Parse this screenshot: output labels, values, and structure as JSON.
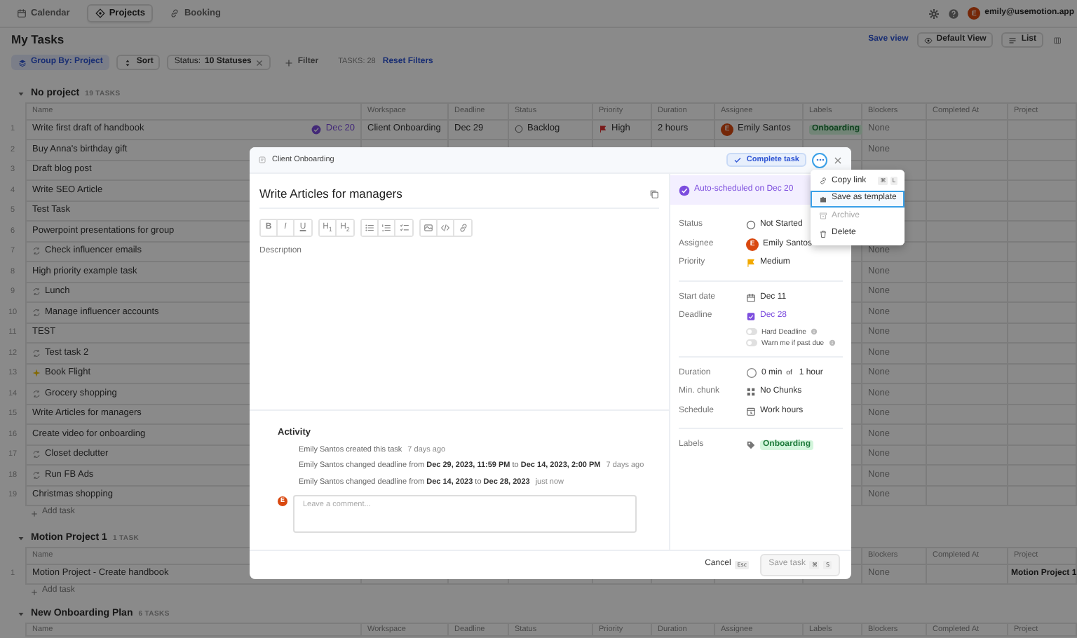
{
  "nav": {
    "tabs": [
      {
        "kind": "calendar",
        "label": "Calendar",
        "selected": false
      },
      {
        "kind": "projects",
        "label": "Projects",
        "selected": true
      },
      {
        "kind": "booking",
        "label": "Booking",
        "selected": false
      }
    ],
    "user": {
      "initial": "E",
      "email": "emily@usemotion.app"
    }
  },
  "page": {
    "title": "My Tasks",
    "save_view": "Save view",
    "view_button": "Default View",
    "view_modes": [
      {
        "kind": "list",
        "label": "List",
        "selected": true
      },
      {
        "kind": "board",
        "selected": false
      }
    ]
  },
  "filters": {
    "group_by": "Group By: Project",
    "sort": "Sort",
    "status_label": "Status:",
    "status_value": "10 Statuses",
    "add_filter": "Filter",
    "task_count": "TASKS: 28",
    "reset": "Reset Filters"
  },
  "groups": [
    {
      "name": "No project",
      "count": "19 TASKS",
      "columns": [
        {
          "kind": "name",
          "label": "Name"
        },
        {
          "kind": "workspace",
          "label": "Workspace"
        },
        {
          "kind": "deadline",
          "label": "Deadline"
        },
        {
          "kind": "status",
          "label": "Status"
        },
        {
          "kind": "priority",
          "label": "Priority"
        },
        {
          "kind": "duration",
          "label": "Duration"
        },
        {
          "kind": "assignee",
          "label": "Assignee"
        },
        {
          "kind": "labels",
          "label": "Labels"
        },
        {
          "kind": "blockers",
          "label": "Blockers"
        },
        {
          "kind": "completed",
          "label": "Completed At"
        },
        {
          "kind": "project",
          "label": "Project"
        }
      ],
      "rows": [
        {
          "num": "1",
          "kind": "task",
          "name": "Write first draft of handbook",
          "scheduled": "Dec 20",
          "workspace": "Client Onboarding",
          "deadline": "Dec 29",
          "status": "Backlog",
          "priority": "High",
          "duration": "2 hours",
          "assignee_initial": "E",
          "assignee": "Emily Santos",
          "labels": "Onboarding",
          "blockers": "None"
        },
        {
          "num": "2",
          "kind": "task",
          "name": "Buy Anna's birthday gift",
          "blockers": "None"
        },
        {
          "num": "3",
          "kind": "task",
          "name": "Draft blog post"
        },
        {
          "num": "4",
          "kind": "task",
          "name": "Write SEO Article"
        },
        {
          "num": "5",
          "kind": "task",
          "name": "Test Task"
        },
        {
          "num": "6",
          "kind": "task",
          "name": "Powerpoint presentations for group"
        },
        {
          "num": "7",
          "kind": "recurring",
          "name": "Check influencer emails",
          "blockers": "None"
        },
        {
          "num": "8",
          "kind": "task",
          "name": "High priority example task",
          "blockers": "None"
        },
        {
          "num": "9",
          "kind": "recurring",
          "name": "Lunch",
          "blockers": "None"
        },
        {
          "num": "10",
          "kind": "recurring",
          "name": "Manage influencer accounts",
          "blockers": "None"
        },
        {
          "num": "11",
          "kind": "task",
          "name": "TEST",
          "blockers": "None"
        },
        {
          "num": "12",
          "kind": "recurring",
          "name": "Test task 2",
          "blockers": "None"
        },
        {
          "num": "13",
          "kind": "sparkle",
          "name": "Book Flight",
          "blockers": "None"
        },
        {
          "num": "14",
          "kind": "recurring",
          "name": "Grocery shopping",
          "blockers": "None"
        },
        {
          "num": "15",
          "kind": "task",
          "name": "Write Articles for managers",
          "blockers": "None"
        },
        {
          "num": "16",
          "kind": "task",
          "name": "Create video for onboarding",
          "blockers": "None"
        },
        {
          "num": "17",
          "kind": "recurring",
          "name": "Closet declutter",
          "blockers": "None"
        },
        {
          "num": "18",
          "kind": "recurring",
          "name": "Run FB Ads",
          "blockers": "None"
        },
        {
          "num": "19",
          "kind": "task",
          "name": "Christmas shopping",
          "blockers": "None"
        }
      ],
      "add_task": "Add task"
    },
    {
      "name": "Motion Project 1",
      "count": "1 TASK",
      "columns": [
        {
          "kind": "name",
          "label": "Name"
        },
        {
          "kind": "blockers",
          "label": "Blockers"
        },
        {
          "kind": "completed",
          "label": "Completed At"
        },
        {
          "kind": "project",
          "label": "Project"
        }
      ],
      "rows": [
        {
          "num": "1",
          "kind": "task",
          "name": "Motion Project - Create handbook",
          "blockers": "None",
          "project": "Motion Project 1"
        }
      ],
      "add_task": "Add task"
    },
    {
      "name": "New Onboarding Plan",
      "count": "6 TASKS",
      "columns": [
        {
          "kind": "name",
          "label": "Name"
        },
        {
          "kind": "workspace",
          "label": "Workspace"
        },
        {
          "kind": "deadline",
          "label": "Deadline"
        },
        {
          "kind": "status",
          "label": "Status"
        },
        {
          "kind": "priority",
          "label": "Priority"
        },
        {
          "kind": "duration",
          "label": "Duration"
        },
        {
          "kind": "assignee",
          "label": "Assignee"
        },
        {
          "kind": "labels",
          "label": "Labels"
        },
        {
          "kind": "blockers",
          "label": "Blockers"
        },
        {
          "kind": "completed",
          "label": "Completed At"
        },
        {
          "kind": "project",
          "label": "Project"
        }
      ]
    }
  ],
  "modal": {
    "breadcrumb": "Client Onboarding",
    "complete": "Complete task",
    "title": "Write Articles for managers",
    "toolbar": [
      [
        {
          "kind": "bold",
          "label": "B"
        },
        {
          "kind": "italic",
          "label": "I"
        },
        {
          "kind": "underline",
          "label": "U"
        }
      ],
      [
        {
          "kind": "heading",
          "label": "H$_{1}$"
        },
        {
          "kind": "heading",
          "label": "H$_{2}$"
        }
      ],
      [
        {
          "kind": "bullets"
        },
        {
          "kind": "numbers"
        },
        {
          "kind": "checklist"
        }
      ],
      [
        {
          "kind": "image"
        },
        {
          "kind": "code"
        },
        {
          "kind": "link"
        }
      ]
    ],
    "description_placeholder": "Description",
    "activity": {
      "title": "Activity",
      "entries": [
        {
          "text": "Emily Santos created this task",
          "time": "7 days ago"
        },
        {
          "text": "Emily Santos changed deadline from **Dec 29, 2023, 11:59 PM** to **Dec 14, 2023, 2:00 PM**",
          "time": "7 days ago"
        },
        {
          "text": "Emily Santos changed deadline from **Dec 14, 2023** to **Dec 28, 2023**",
          "time": "just now"
        }
      ],
      "comment_avatar": "E",
      "comment_placeholder": "Leave a comment..."
    },
    "auto_scheduled": "Auto-scheduled on Dec 20",
    "property_groups": [
      [
        {
          "kind": "status",
          "label": "Status",
          "value": "Not Started"
        },
        {
          "kind": "assignee",
          "label": "Assignee",
          "initial": "E",
          "value": "Emily Santos"
        },
        {
          "kind": "priority",
          "label": "Priority",
          "value": "Medium",
          "color": "#f2a900"
        }
      ],
      [
        {
          "kind": "start",
          "label": "Start date",
          "value": "Dec 11"
        },
        {
          "kind": "deadline",
          "label": "Deadline",
          "value": "Dec 28",
          "toggles": [
            {
              "label": "Hard Deadline",
              "on": false
            },
            {
              "label": "Warn me if past due",
              "on": false
            }
          ]
        }
      ],
      [
        {
          "kind": "duration",
          "label": "Duration",
          "value": "0 min",
          "joiner": "of",
          "value_2": "1 hour"
        },
        {
          "kind": "chunk",
          "label": "Min. chunk",
          "value": "No Chunks"
        },
        {
          "kind": "schedule",
          "label": "Schedule",
          "value": "Work hours"
        }
      ],
      [
        {
          "kind": "labels",
          "label": "Labels",
          "value": "Onboarding"
        }
      ]
    ],
    "footer": {
      "cancel": "Cancel",
      "cancel_key": "Esc",
      "save": "Save task",
      "save_keys": [
        "⌘",
        "S"
      ],
      "save_disabled": true
    }
  },
  "menu": {
    "items": [
      {
        "kind": "copy",
        "label": "Copy link",
        "shortcut": [
          "⌘",
          "L"
        ],
        "selected": false,
        "disabled": false
      },
      {
        "kind": "template",
        "label": "Save as template",
        "selected": true,
        "disabled": false
      },
      {
        "kind": "archive",
        "label": "Archive",
        "selected": false,
        "disabled": true
      },
      {
        "kind": "delete",
        "label": "Delete",
        "selected": false,
        "disabled": false
      }
    ]
  }
}
